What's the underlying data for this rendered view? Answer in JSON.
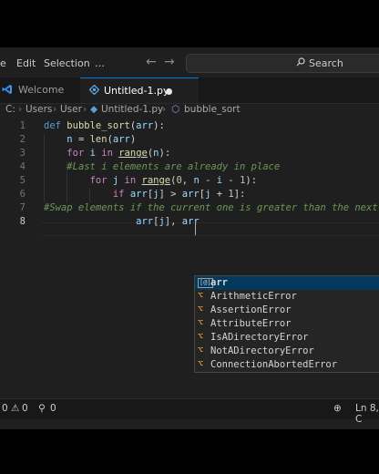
{
  "menubar": {
    "items": [
      "e",
      "Edit",
      "Selection",
      "…"
    ],
    "nav_back_icon": "arrow-left-icon",
    "nav_forward_icon": "arrow-right-icon",
    "search_label": "Search"
  },
  "tabs": [
    {
      "label": "Welcome",
      "icon": "vscode-logo-icon"
    },
    {
      "label": "Untitled-1.py",
      "icon": "python-file-icon",
      "modified": true
    }
  ],
  "breadcrumb": [
    "C:",
    "Users",
    "User",
    "Untitled-1.py",
    "bubble_sort"
  ],
  "editor": {
    "line_numbers": [
      "1",
      "2",
      "3",
      "4",
      "5",
      "6",
      "7",
      "8"
    ],
    "lines": [
      "def bubble_sort(arr):",
      "    n = len(arr)",
      "    for i in range(n):",
      "    #Last i elements are already in place",
      "        for j in range(0, n - i - 1):",
      "            if arr[j] > arr[j + 1]:",
      "#Swap elements if the current one is greater than the next",
      "                arr[j], arr"
    ]
  },
  "suggest": {
    "items": [
      {
        "label": "arr",
        "kind": "variable"
      },
      {
        "label": "ArithmeticError",
        "kind": "class"
      },
      {
        "label": "AssertionError",
        "kind": "class"
      },
      {
        "label": "AttributeError",
        "kind": "class"
      },
      {
        "label": "IsADirectoryError",
        "kind": "class"
      },
      {
        "label": "NotADirectoryError",
        "kind": "class"
      },
      {
        "label": "ConnectionAbortedError",
        "kind": "class"
      }
    ]
  },
  "statusbar": {
    "errors": "0",
    "warnings": "0",
    "ports": "0",
    "position": "Ln 8, C"
  },
  "colors": {
    "keyword": "#569cd6",
    "control": "#c586c0",
    "function": "#dcdcaa",
    "variable": "#9cdcfe",
    "comment": "#6a9955",
    "accent": "#0078d4"
  }
}
